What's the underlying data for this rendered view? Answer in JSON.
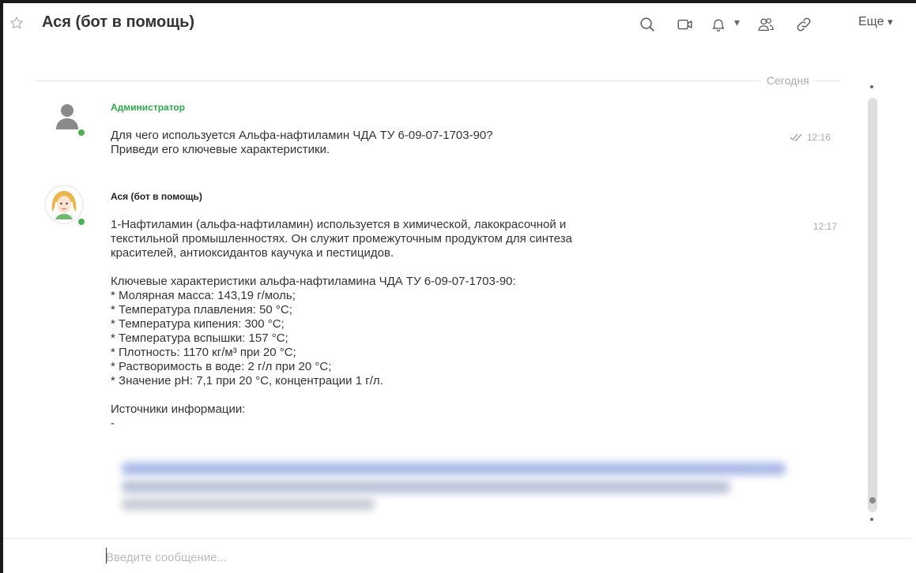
{
  "header": {
    "title": "Ася (бот в помощь)",
    "more_label": "Еще"
  },
  "chat": {
    "date_label": "Сегодня",
    "messages": [
      {
        "author": "Администратор",
        "author_color": "#2ea84a",
        "text": "Для чего используется Альфа-нафтиламин ЧДА ТУ 6-09-07-1703-90?\nПриведи его ключевые характеристики.",
        "time": "12:16",
        "read": true
      },
      {
        "author": "Ася (бот в помощь)",
        "author_color": "#222222",
        "text": "1-Нафтиламин (альфа-нафтиламин) используется в химической, лакокрасочной и\nтекстильной промышленностях. Он служит промежуточным продуктом для синтеза\nкрасителей, антиоксидантов каучука и пестицидов.\n\nКлючевые характеристики альфа-нафтиламина ЧДА ТУ 6-09-07-1703-90:\n* Молярная масса: 143,19 г/моль;\n* Температура плавления: 50 °С;\n* Температура кипения: 300 °С;\n* Температура вспышки: 157 °С;\n* Плотность: 1170 кг/м³ при 20 °С;\n* Растворимость в воде: 2 г/л при 20 °С;\n* Значение pH: 7,1 при 20 °С, концентрации 1 г/л.\n\nИсточники информации:\n-",
        "time": "12:17"
      }
    ]
  },
  "input": {
    "placeholder": "Введите сообщение..."
  },
  "colors": {
    "online": "#4caf50",
    "accent_green": "#2ea84a",
    "blurred_link": "#a9b8e8"
  }
}
